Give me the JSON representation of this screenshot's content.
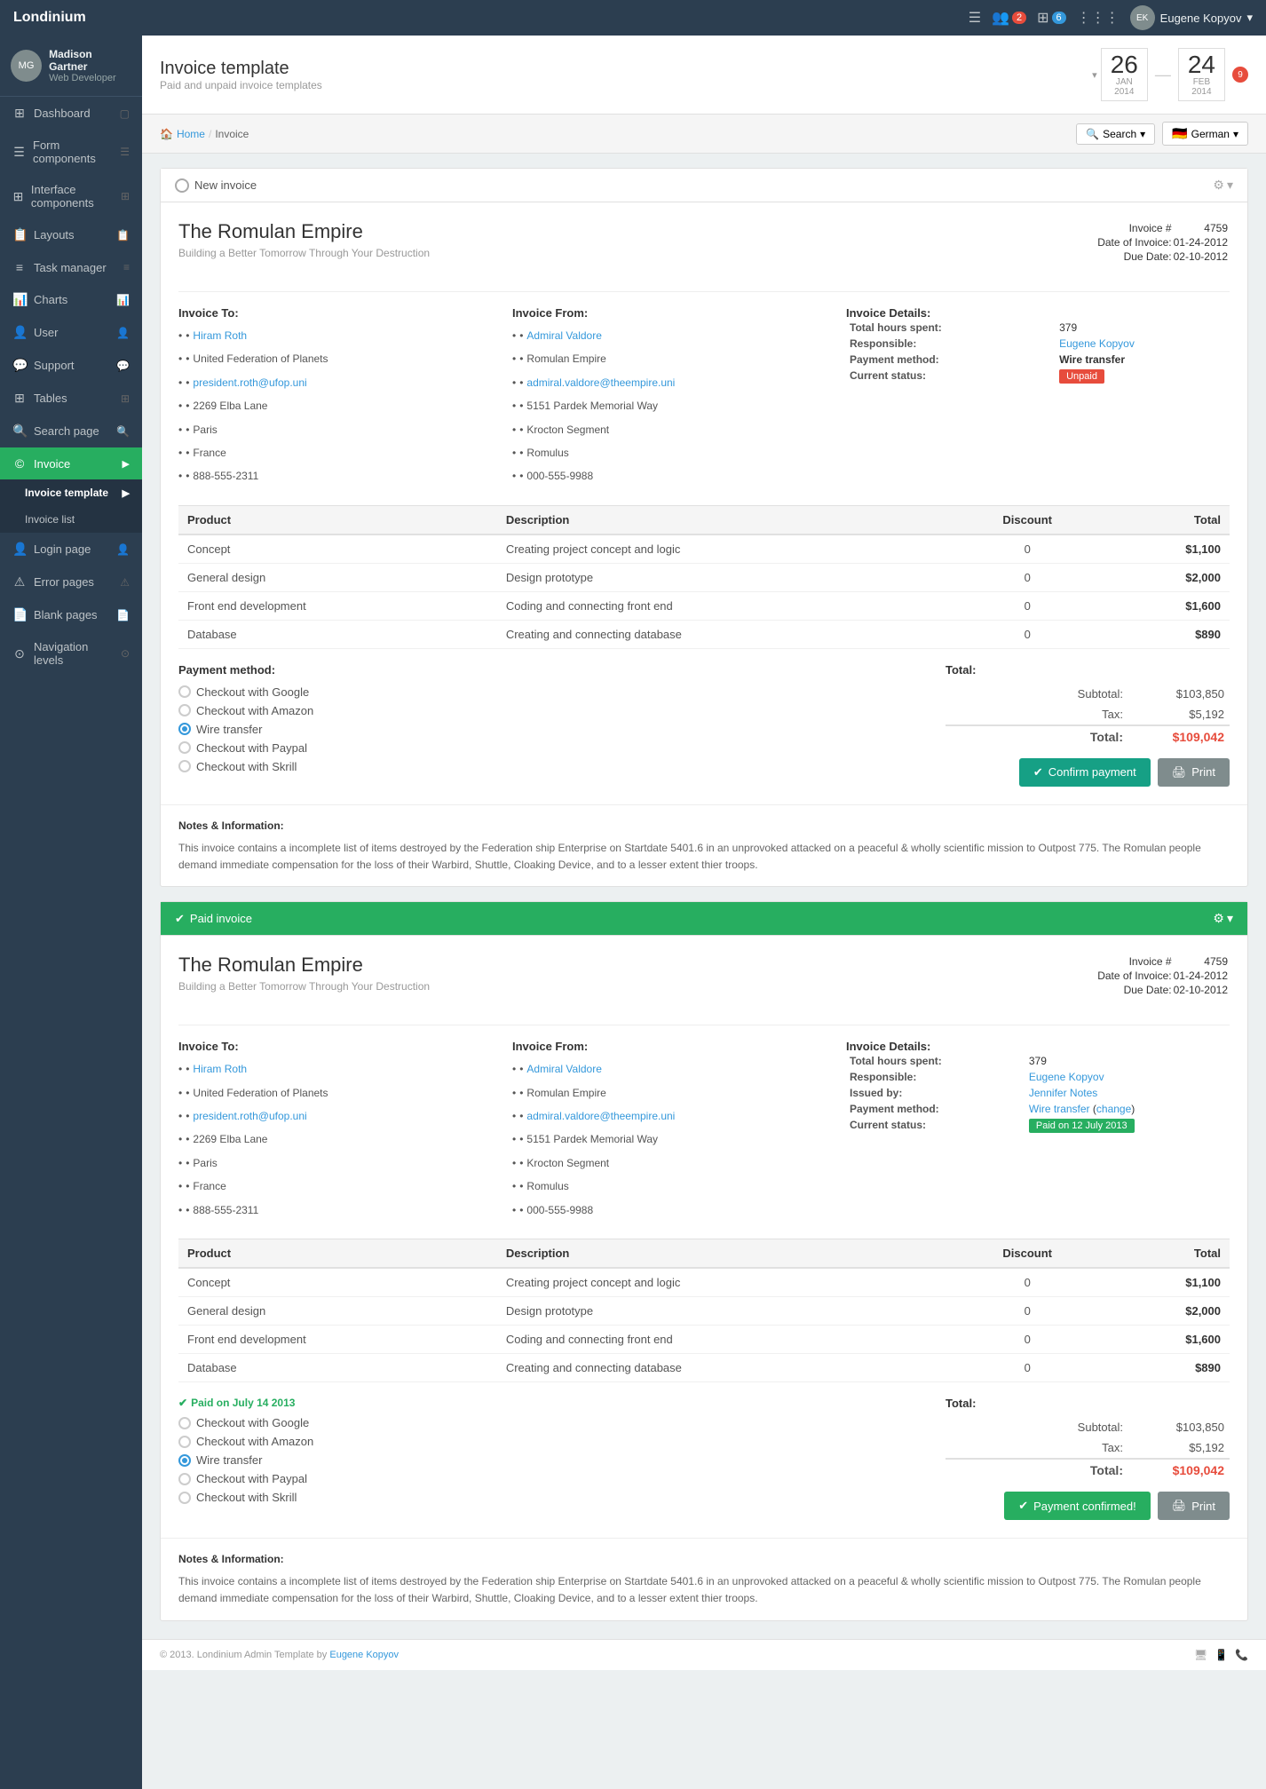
{
  "app": {
    "brand": "Londinium",
    "topnav": {
      "icon_menu": "☰",
      "badge1": "2",
      "badge2": "6",
      "user_name": "Eugene Kopyov",
      "user_avatar_initials": "EK"
    }
  },
  "sidebar": {
    "user": {
      "name": "Madison Gartner",
      "role": "Web Developer"
    },
    "items": [
      {
        "id": "dashboard",
        "label": "Dashboard",
        "icon": "⊞"
      },
      {
        "id": "form-components",
        "label": "Form components",
        "icon": "☰"
      },
      {
        "id": "interface-components",
        "label": "Interface components",
        "icon": "⊞"
      },
      {
        "id": "layouts",
        "label": "Layouts",
        "icon": "📋"
      },
      {
        "id": "task-manager",
        "label": "Task manager",
        "icon": "≡"
      },
      {
        "id": "charts",
        "label": "Charts",
        "icon": "📊"
      },
      {
        "id": "user",
        "label": "User",
        "icon": "👤"
      },
      {
        "id": "support",
        "label": "Support",
        "icon": "💬"
      },
      {
        "id": "tables",
        "label": "Tables",
        "icon": "⊞"
      },
      {
        "id": "search-page",
        "label": "Search page",
        "icon": "🔍"
      },
      {
        "id": "invoice",
        "label": "Invoice",
        "icon": "©",
        "active": true,
        "has_sub": true
      },
      {
        "id": "login-page",
        "label": "Login page",
        "icon": "👤"
      },
      {
        "id": "error-pages",
        "label": "Error pages",
        "icon": "⚠"
      },
      {
        "id": "blank-pages",
        "label": "Blank pages",
        "icon": "📄"
      },
      {
        "id": "navigation-levels",
        "label": "Navigation levels",
        "icon": "⊙"
      }
    ],
    "sub_items": [
      {
        "id": "invoice-template",
        "label": "Invoice template",
        "active": true
      },
      {
        "id": "invoice-list",
        "label": "Invoice list"
      }
    ]
  },
  "page": {
    "title": "Invoice template",
    "subtitle": "Paid and unpaid invoice templates",
    "date1": {
      "day": "26",
      "month": "JAN",
      "year": "2014"
    },
    "date2": {
      "day": "24",
      "month": "FEB",
      "year": "2014"
    },
    "badge": "9",
    "breadcrumb": {
      "home": "Home",
      "current": "Invoice"
    },
    "search_label": "Search",
    "language": "German"
  },
  "invoice1": {
    "header_label": "New invoice",
    "company": {
      "name": "The Romulan Empire",
      "tagline": "Building a Better Tomorrow Through Your Destruction"
    },
    "meta": {
      "invoice_no_label": "Invoice #",
      "invoice_no": "4759",
      "date_label": "Date of Invoice:",
      "date_val": "01-24-2012",
      "due_label": "Due Date:",
      "due_val": "02-10-2012"
    },
    "invoice_to": {
      "title": "Invoice To:",
      "items": [
        "Hiram Roth",
        "United Federation of Planets",
        "president.roth@ufop.uni",
        "2269 Elba Lane",
        "Paris",
        "France",
        "888-555-2311"
      ],
      "link_index": 0,
      "email_index": 2
    },
    "invoice_from": {
      "title": "Invoice From:",
      "items": [
        "Admiral Valdore",
        "Romulan Empire",
        "admiral.valdore@theempire.uni",
        "5151 Pardek Memorial Way",
        "Krocton Segment",
        "Romulus",
        "000-555-9988"
      ],
      "link_index": 0,
      "email_index": 2
    },
    "invoice_details": {
      "title": "Invoice Details:",
      "hours_label": "Total hours spent:",
      "hours_val": "379",
      "responsible_label": "Responsible:",
      "responsible_val": "Eugene Kopyov",
      "payment_method_label": "Payment method:",
      "payment_method_val": "Wire transfer",
      "status_label": "Current status:",
      "status_val": "Unpaid",
      "status_type": "unpaid"
    },
    "products": [
      {
        "product": "Concept",
        "description": "Creating project concept and logic",
        "discount": "0",
        "total": "$1,100"
      },
      {
        "product": "General design",
        "description": "Design prototype",
        "discount": "0",
        "total": "$2,000"
      },
      {
        "product": "Front end development",
        "description": "Coding and connecting front end",
        "discount": "0",
        "total": "$1,600"
      },
      {
        "product": "Database",
        "description": "Creating and connecting database",
        "discount": "0",
        "total": "$890"
      }
    ],
    "table_headers": [
      "Product",
      "Description",
      "Discount",
      "Total"
    ],
    "payment": {
      "title": "Payment method:",
      "options": [
        {
          "label": "Checkout with Google",
          "checked": false
        },
        {
          "label": "Checkout with Amazon",
          "checked": false
        },
        {
          "label": "Wire transfer",
          "checked": true
        },
        {
          "label": "Checkout with Paypal",
          "checked": false
        },
        {
          "label": "Checkout with Skrill",
          "checked": false
        }
      ]
    },
    "totals": {
      "title": "Total:",
      "subtotal_label": "Subtotal:",
      "subtotal_val": "$103,850",
      "tax_label": "Tax:",
      "tax_val": "$5,192",
      "total_label": "Total:",
      "total_val": "$109,042"
    },
    "actions": {
      "confirm_label": "Confirm payment",
      "print_label": "Print"
    },
    "notes": {
      "title": "Notes & Information:",
      "text": "This invoice contains a incomplete list of items destroyed by the Federation ship Enterprise on Startdate 5401.6 in an unprovoked attacked on a peaceful & wholly scientific mission to Outpost 775. The Romulan people demand immediate compensation for the loss of their Warbird, Shuttle, Cloaking Device, and to a lesser extent thier troops."
    }
  },
  "invoice2": {
    "header_label": "Paid invoice",
    "company": {
      "name": "The Romulan Empire",
      "tagline": "Building a Better Tomorrow Through Your Destruction"
    },
    "meta": {
      "invoice_no_label": "Invoice #",
      "invoice_no": "4759",
      "date_label": "Date of Invoice:",
      "date_val": "01-24-2012",
      "due_label": "Due Date:",
      "due_val": "02-10-2012"
    },
    "invoice_to": {
      "title": "Invoice To:",
      "items": [
        "Hiram Roth",
        "United Federation of Planets",
        "president.roth@ufop.uni",
        "2269 Elba Lane",
        "Paris",
        "France",
        "888-555-2311"
      ]
    },
    "invoice_from": {
      "title": "Invoice From:",
      "items": [
        "Admiral Valdore",
        "Romulan Empire",
        "admiral.valdore@theempire.uni",
        "5151 Pardek Memorial Way",
        "Krocton Segment",
        "Romulus",
        "000-555-9988"
      ]
    },
    "invoice_details": {
      "title": "Invoice Details:",
      "hours_label": "Total hours spent:",
      "hours_val": "379",
      "responsible_label": "Responsible:",
      "responsible_val": "Eugene Kopyov",
      "issued_label": "Issued by:",
      "issued_val": "Jennifer Notes",
      "payment_method_label": "Payment method:",
      "payment_method_val": "Wire transfer",
      "payment_change": "change",
      "status_label": "Current status:",
      "status_val": "Paid on 12 July 2013",
      "status_type": "paid"
    },
    "products": [
      {
        "product": "Concept",
        "description": "Creating project concept and logic",
        "discount": "0",
        "total": "$1,100"
      },
      {
        "product": "General design",
        "description": "Design prototype",
        "discount": "0",
        "total": "$2,000"
      },
      {
        "product": "Front end development",
        "description": "Coding and connecting front end",
        "discount": "0",
        "total": "$1,600"
      },
      {
        "product": "Database",
        "description": "Creating and connecting database",
        "discount": "0",
        "total": "$890"
      }
    ],
    "table_headers": [
      "Product",
      "Description",
      "Discount",
      "Total"
    ],
    "payment": {
      "title": "Paid on July 14 2013",
      "options": [
        {
          "label": "Checkout with Google",
          "checked": false
        },
        {
          "label": "Checkout with Amazon",
          "checked": false
        },
        {
          "label": "Wire transfer",
          "checked": true
        },
        {
          "label": "Checkout with Paypal",
          "checked": false
        },
        {
          "label": "Checkout with Skrill",
          "checked": false
        }
      ]
    },
    "totals": {
      "title": "Total:",
      "subtotal_label": "Subtotal:",
      "subtotal_val": "$103,850",
      "tax_label": "Tax:",
      "tax_val": "$5,192",
      "total_label": "Total:",
      "total_val": "$109,042"
    },
    "actions": {
      "confirm_label": "Payment confirmed!",
      "print_label": "Print"
    },
    "notes": {
      "title": "Notes & Information:",
      "text": "This invoice contains a incomplete list of items destroyed by the Federation ship Enterprise on Startdate 5401.6 in an unprovoked attacked on a peaceful & wholly scientific mission to Outpost 775. The Romulan people demand immediate compensation for the loss of their Warbird, Shuttle, Cloaking Device, and to a lesser extent thier troops."
    }
  },
  "footer": {
    "copyright": "© 2013. Londinium Admin Template by",
    "author": "Eugene Kopyov"
  }
}
